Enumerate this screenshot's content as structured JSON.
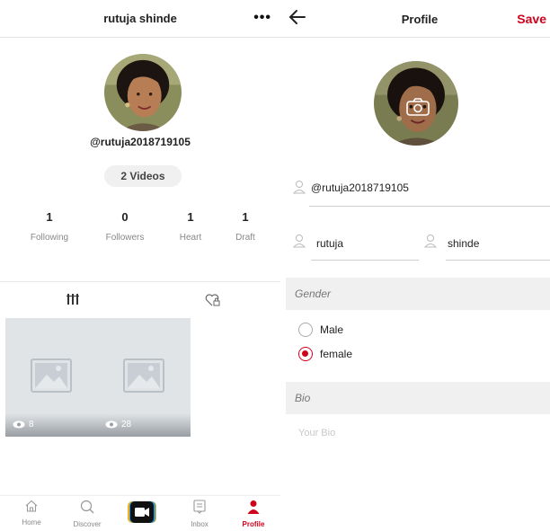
{
  "left": {
    "header": {
      "title": "rutuja shinde",
      "more_label": "•••"
    },
    "username": "@rutuja2018719105",
    "videos_label": "2 Videos",
    "stats": [
      {
        "value": "1",
        "label": "Following"
      },
      {
        "value": "0",
        "label": "Followers"
      },
      {
        "value": "1",
        "label": "Heart"
      },
      {
        "value": "1",
        "label": "Draft"
      }
    ],
    "tabs": [
      {
        "icon": "grid-icon"
      },
      {
        "icon": "liked-heart-lock-icon"
      }
    ],
    "videos": [
      {
        "views": "8",
        "icon": "image-placeholder-icon"
      },
      {
        "views": "28",
        "icon": "image-placeholder-icon"
      }
    ],
    "bottom_nav": [
      {
        "label": "Home",
        "icon": "home-icon"
      },
      {
        "label": "Discover",
        "icon": "search-icon"
      },
      {
        "label": "",
        "icon": "video-camera-icon"
      },
      {
        "label": "Inbox",
        "icon": "inbox-icon"
      },
      {
        "label": "Profile",
        "icon": "profile-icon",
        "active": true
      }
    ]
  },
  "right": {
    "header": {
      "title": "Profile",
      "save_label": "Save",
      "back_icon": "back-arrow-icon"
    },
    "username_field": {
      "value": "@rutuja2018719105",
      "icon": "person-icon"
    },
    "first_name": {
      "value": "rutuja",
      "icon": "person-icon"
    },
    "last_name": {
      "value": "shinde",
      "icon": "person-icon"
    },
    "gender": {
      "header": "Gender",
      "options": [
        {
          "label": "Male",
          "selected": false
        },
        {
          "label": "female",
          "selected": true
        }
      ]
    },
    "bio": {
      "header": "Bio",
      "placeholder": "Your Bio"
    }
  },
  "colors": {
    "accent": "#d0021b",
    "section_bg": "#f0f0f0",
    "tile_bg": "#e0e4e7"
  }
}
